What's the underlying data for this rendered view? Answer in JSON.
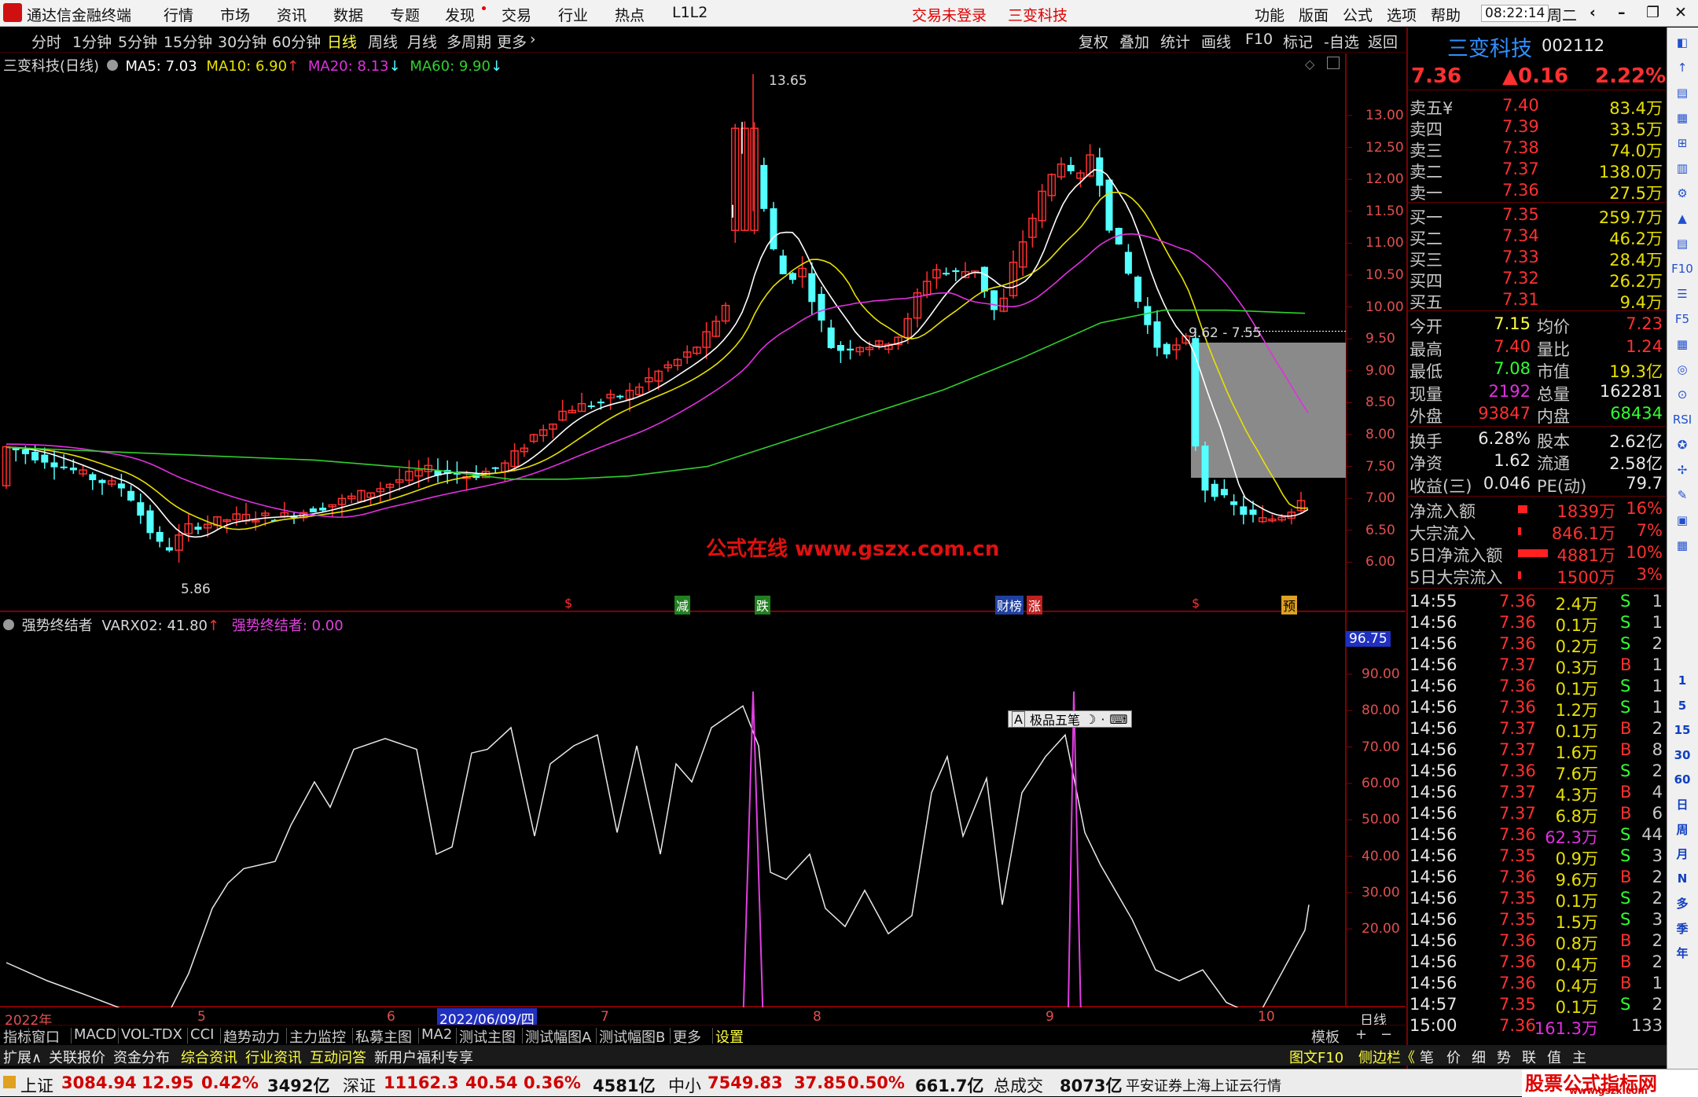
{
  "menu": {
    "app_title": "通达信金融终端",
    "items": [
      "行情",
      "市场",
      "资讯",
      "数据",
      "专题",
      "发现",
      "交易",
      "行业",
      "热点",
      "L1L2"
    ],
    "trade_status": "交易未登录",
    "stock_name": "三变科技",
    "right_items": [
      "功能",
      "版面",
      "公式",
      "选项",
      "帮助"
    ],
    "time": "08:22:14",
    "weekday": "周二"
  },
  "periods": {
    "items": [
      "分时",
      "1分钟",
      "5分钟",
      "15分钟",
      "30分钟",
      "60分钟",
      "日线",
      "周线",
      "月线",
      "多周期",
      "更多"
    ],
    "active": "日线",
    "tools": [
      "复权",
      "叠加",
      "统计",
      "画线",
      "F10",
      "标记",
      "-自选",
      "返回"
    ]
  },
  "stock": {
    "name": "三变科技",
    "code": "002112",
    "price": "7.36",
    "change": "▲0.16",
    "pct": "2.22%"
  },
  "chart": {
    "title": "三变科技(日线)",
    "ma5": "MA5: 7.03",
    "ma10": "MA10: 6.90",
    "ma20": "MA20: 8.13",
    "ma60": "MA60: 9.90",
    "price_labels": [
      "13.00",
      "12.50",
      "12.00",
      "11.50",
      "11.00",
      "10.50",
      "10.00",
      "9.50",
      "9.00",
      "8.50",
      "8.00",
      "7.50",
      "7.00",
      "6.50",
      "6.00"
    ],
    "high_label": "13.65",
    "low_label": "5.86",
    "box_label": "9.62 - 7.55",
    "watermark": "公式在线  www.gszx.com.cn",
    "event_marks": [
      "$",
      "减",
      "跌",
      "财榜",
      "涨",
      "$",
      "预"
    ],
    "ind_title": "强势终结者",
    "ind_value": "VARX02: 41.80",
    "ind_value2": "强势终结者: 0.00",
    "ind_labels": [
      "90.00",
      "80.00",
      "70.00",
      "60.00",
      "50.00",
      "40.00",
      "30.00",
      "20.00"
    ],
    "ind_cursor": "96.75",
    "input_popup": "极品五笔",
    "date_labels": [
      "2022年",
      "5",
      "6",
      "2022/06/09/四",
      "7",
      "8",
      "9",
      "10"
    ],
    "period_label": "日线"
  },
  "colors": {
    "up": "#ff3030",
    "down": "#54ffff",
    "ma5": "#ffffff",
    "ma10": "#e8e000",
    "ma20": "#e030e0",
    "ma60": "#30d030",
    "pink": "#e040e0"
  },
  "orderbook": {
    "asks": [
      {
        "label": "卖五¥",
        "price": "7.40",
        "vol": "83.4万"
      },
      {
        "label": "卖四",
        "price": "7.39",
        "vol": "33.5万"
      },
      {
        "label": "卖三",
        "price": "7.38",
        "vol": "74.0万"
      },
      {
        "label": "卖二",
        "price": "7.37",
        "vol": "138.0万"
      },
      {
        "label": "卖一",
        "price": "7.36",
        "vol": "27.5万"
      }
    ],
    "bids": [
      {
        "label": "买一",
        "price": "7.35",
        "vol": "259.7万"
      },
      {
        "label": "买二",
        "price": "7.34",
        "vol": "46.2万"
      },
      {
        "label": "买三",
        "price": "7.33",
        "vol": "28.4万"
      },
      {
        "label": "买四",
        "price": "7.32",
        "vol": "26.2万"
      },
      {
        "label": "买五",
        "price": "7.31",
        "vol": "9.4万"
      }
    ]
  },
  "quote": [
    {
      "l1": "今开",
      "v1": "7.15",
      "l2": "均价",
      "v2": "7.23"
    },
    {
      "l1": "最高",
      "v1": "7.40",
      "l2": "量比",
      "v2": "1.24"
    },
    {
      "l1": "最低",
      "v1": "7.08",
      "l2": "市值",
      "v2": "19.3亿"
    },
    {
      "l1": "现量",
      "v1": "2192",
      "l2": "总量",
      "v2": "162281"
    },
    {
      "l1": "外盘",
      "v1": "93847",
      "l2": "内盘",
      "v2": "68434"
    },
    {
      "l1": "换手",
      "v1": "6.28%",
      "l2": "股本",
      "v2": "2.62亿"
    },
    {
      "l1": "净资",
      "v1": "1.62",
      "l2": "流通",
      "v2": "2.58亿"
    },
    {
      "l1": "收益(三)",
      "v1": "0.046",
      "l2": "PE(动)",
      "v2": "79.7"
    }
  ],
  "flows": [
    {
      "label": "净流入额",
      "value": "1839万",
      "pct": "16%"
    },
    {
      "label": "大宗流入",
      "value": "846.1万",
      "pct": "7%"
    },
    {
      "label": "5日净流入额",
      "value": "4881万",
      "pct": "10%"
    },
    {
      "label": "5日大宗流入",
      "value": "1500万",
      "pct": "3%"
    }
  ],
  "ticks": [
    {
      "t": "14:55",
      "p": "7.36",
      "v": "2.4万",
      "s": "S",
      "n": "1"
    },
    {
      "t": "14:56",
      "p": "7.36",
      "v": "0.1万",
      "s": "S",
      "n": "1"
    },
    {
      "t": "14:56",
      "p": "7.36",
      "v": "0.2万",
      "s": "S",
      "n": "2"
    },
    {
      "t": "14:56",
      "p": "7.37",
      "v": "0.3万",
      "s": "B",
      "n": "1"
    },
    {
      "t": "14:56",
      "p": "7.36",
      "v": "0.1万",
      "s": "S",
      "n": "1"
    },
    {
      "t": "14:56",
      "p": "7.36",
      "v": "1.2万",
      "s": "S",
      "n": "1"
    },
    {
      "t": "14:56",
      "p": "7.37",
      "v": "0.1万",
      "s": "B",
      "n": "2"
    },
    {
      "t": "14:56",
      "p": "7.37",
      "v": "1.6万",
      "s": "B",
      "n": "8"
    },
    {
      "t": "14:56",
      "p": "7.36",
      "v": "7.6万",
      "s": "S",
      "n": "2"
    },
    {
      "t": "14:56",
      "p": "7.37",
      "v": "4.3万",
      "s": "B",
      "n": "4"
    },
    {
      "t": "14:56",
      "p": "7.37",
      "v": "6.8万",
      "s": "B",
      "n": "6"
    },
    {
      "t": "14:56",
      "p": "7.36",
      "v": "62.3万",
      "s": "S",
      "n": "44"
    },
    {
      "t": "14:56",
      "p": "7.35",
      "v": "0.9万",
      "s": "S",
      "n": "3"
    },
    {
      "t": "14:56",
      "p": "7.36",
      "v": "9.6万",
      "s": "B",
      "n": "2"
    },
    {
      "t": "14:56",
      "p": "7.35",
      "v": "0.1万",
      "s": "S",
      "n": "2"
    },
    {
      "t": "14:56",
      "p": "7.35",
      "v": "1.5万",
      "s": "S",
      "n": "3"
    },
    {
      "t": "14:56",
      "p": "7.36",
      "v": "0.8万",
      "s": "B",
      "n": "2"
    },
    {
      "t": "14:56",
      "p": "7.36",
      "v": "0.4万",
      "s": "B",
      "n": "2"
    },
    {
      "t": "14:56",
      "p": "7.36",
      "v": "0.4万",
      "s": "B",
      "n": "1"
    },
    {
      "t": "14:57",
      "p": "7.35",
      "v": "0.1万",
      "s": "S",
      "n": "2"
    },
    {
      "t": "15:00",
      "p": "7.36",
      "v": "161.3万",
      "s": "",
      "n": "133"
    }
  ],
  "bottom_tabs": [
    "指标",
    "窗口",
    "MACD",
    "VOL-TDX",
    "CCI",
    "趋势动力",
    "主力监控",
    "私募主图",
    "MA2",
    "测试主图",
    "测试幅图A",
    "测试幅图B",
    "更多",
    "设置"
  ],
  "bottom_right": [
    "模板",
    "+",
    "−"
  ],
  "bottom_tabs2": [
    "扩展∧",
    "关联报价",
    "资金分布",
    "综合资讯",
    "行业资讯",
    "互动问答",
    "新用户福利专享"
  ],
  "bottom_tabs2_right": [
    "图文F10",
    "侧边栏《",
    "笔",
    "价",
    "细",
    "势",
    "联",
    "值",
    "主"
  ],
  "status": {
    "sh_label": "上证",
    "sh_val": "3084.94",
    "sh_chg": "12.95",
    "sh_pct": "0.42%",
    "sh_amt": "3492亿",
    "sz_label": "深证",
    "sz_val": "11162.3",
    "sz_chg": "40.54",
    "sz_pct": "0.36%",
    "sz_amt": "4581亿",
    "zx_label": "中小",
    "zx_val": "7549.83",
    "zx_chg": "37.85",
    "zx_pct": "0.50%",
    "zx_amt": "661.7亿",
    "total_label": "总成交",
    "total_val": "8073亿",
    "broker": "平安证券上海上证云行情",
    "logo": "股票公式指标网",
    "logo_url": "www.gszx.com"
  },
  "side_icons": [
    "◧",
    "↑",
    "▤",
    "▦",
    "⊞",
    "▥",
    "⚙",
    "▲",
    "▤",
    "F10",
    "☰",
    "F5",
    "▦",
    "◎",
    "⊙",
    "RSI",
    "✪",
    "✢",
    "✎",
    "▣",
    "▦",
    "1",
    "5",
    "15",
    "30",
    "60",
    "日",
    "周",
    "月",
    "N",
    "多",
    "季",
    "年"
  ]
}
